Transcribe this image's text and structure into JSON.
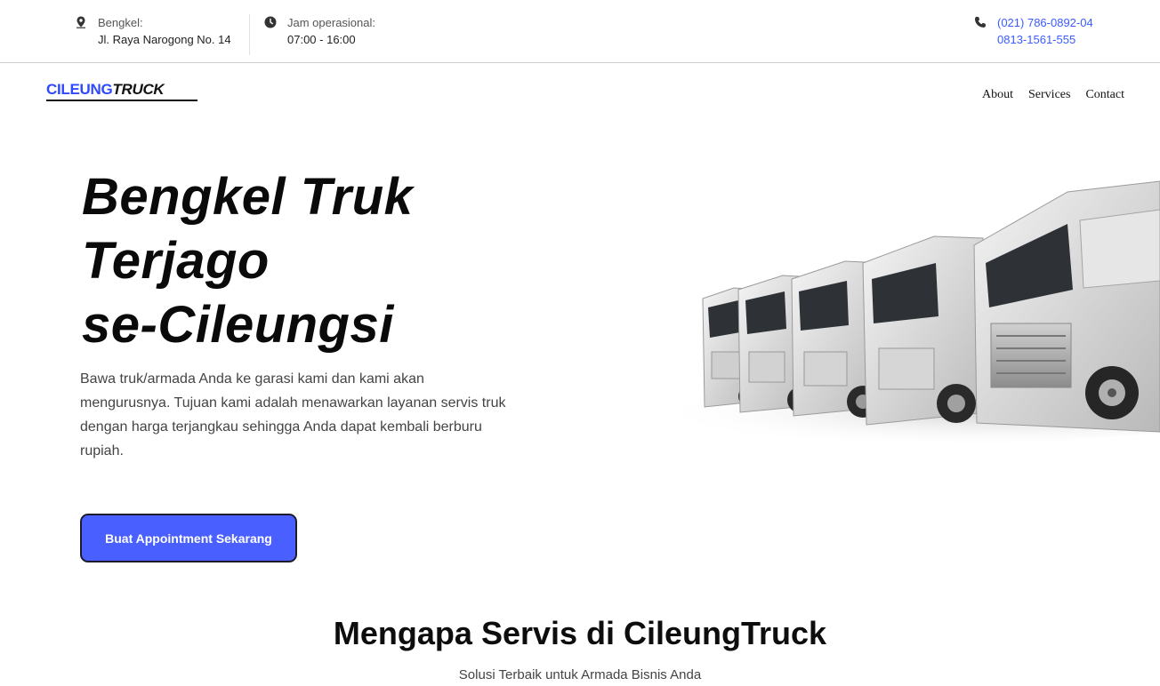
{
  "topbar": {
    "address": {
      "label": "Bengkel:",
      "value": "Jl. Raya Narogong No. 14",
      "icon": "location-pin-icon"
    },
    "hours": {
      "label": "Jam operasional:",
      "value": "07:00 - 16:00",
      "icon": "clock-icon"
    },
    "phone": {
      "line1": "(021) 786-0892-04",
      "line2": "0813-1561-555",
      "icon": "phone-icon",
      "color": "#3b5bff"
    }
  },
  "brand": {
    "part1": "CILEUNG",
    "part2": "TRUCK",
    "accent": "#2f49ff"
  },
  "nav": {
    "about": "About",
    "services": "Services",
    "contact": "Contact"
  },
  "hero": {
    "title_line1": "Bengkel Truk",
    "title_line2": "Terjago",
    "title_line3": "se-Cileungsi",
    "description": "Bawa truk/armada Anda ke garasi kami dan kami akan mengurusnya. Tujuan kami adalah menawarkan layanan servis truk dengan harga terjangkau sehingga Anda dapat kembali berburu rupiah.",
    "cta_label": "Buat Appointment Sekarang",
    "cta_color": "#4a5fff"
  },
  "section": {
    "title": "Mengapa Servis di CileungTruck",
    "subtitle": "Solusi Terbaik untuk Armada Bisnis Anda"
  }
}
